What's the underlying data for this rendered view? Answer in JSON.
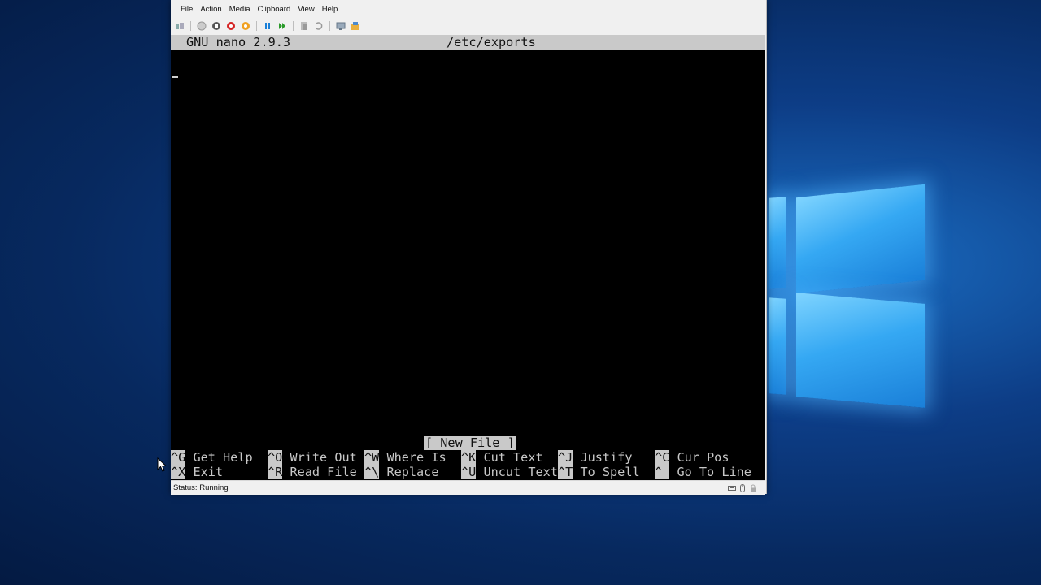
{
  "vm": {
    "menu": [
      "File",
      "Action",
      "Media",
      "Clipboard",
      "View",
      "Help"
    ],
    "toolbar_icons": [
      "ctrl-alt-del-icon",
      "start-icon",
      "turn-off-icon",
      "shut-down-icon",
      "save-icon",
      "pause-icon",
      "reset-icon",
      "checkpoint-icon",
      "revert-icon",
      "enhanced-session-icon",
      "share-icon"
    ],
    "status": "Status: Running"
  },
  "nano": {
    "version": "GNU nano 2.9.3",
    "filename": "/etc/exports",
    "message": "[ New File ]",
    "shortcuts_row1": [
      {
        "key": "^G",
        "label": "Get Help"
      },
      {
        "key": "^O",
        "label": "Write Out"
      },
      {
        "key": "^W",
        "label": "Where Is"
      },
      {
        "key": "^K",
        "label": "Cut Text"
      },
      {
        "key": "^J",
        "label": "Justify"
      },
      {
        "key": "^C",
        "label": "Cur Pos"
      }
    ],
    "shortcuts_row2": [
      {
        "key": "^X",
        "label": "Exit"
      },
      {
        "key": "^R",
        "label": "Read File"
      },
      {
        "key": "^\\",
        "label": "Replace"
      },
      {
        "key": "^U",
        "label": "Uncut Text"
      },
      {
        "key": "^T",
        "label": "To Spell"
      },
      {
        "key": "^_",
        "label": "Go To Line"
      }
    ]
  },
  "colors": {
    "terminal_bg": "#000000",
    "terminal_fg": "#c8c8c8",
    "nano_bar": "#c9c9c9",
    "desktop_accent": "#35a8f3"
  }
}
